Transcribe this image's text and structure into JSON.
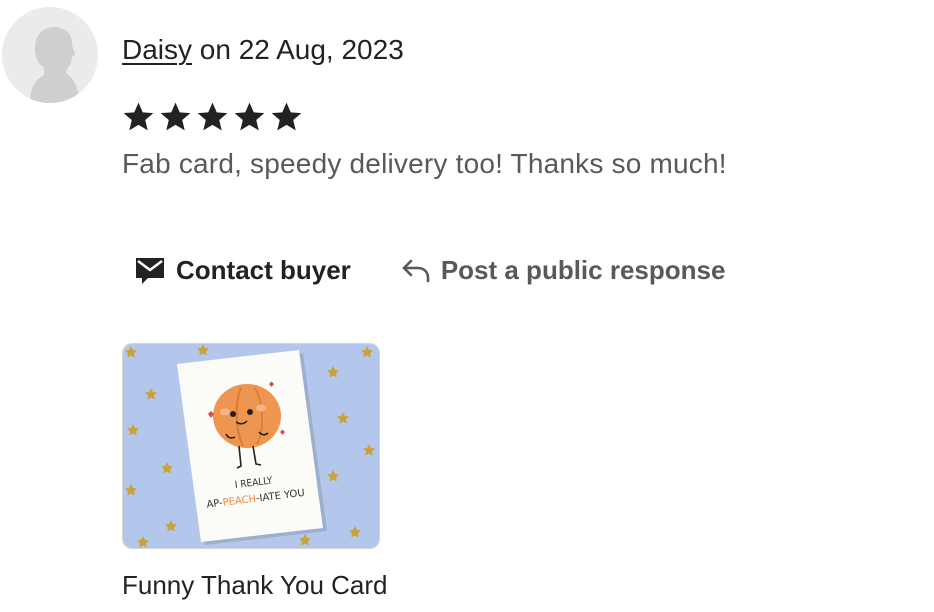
{
  "review": {
    "author": "Daisy",
    "date_text": " on 22 Aug, 2023",
    "rating": 5,
    "max_rating": 5,
    "text": "Fab card, speedy delivery too! Thanks so much!"
  },
  "actions": {
    "contact_label": "Contact buyer",
    "respond_label": "Post a public response"
  },
  "photo": {
    "card_text_line1": "I REALLY",
    "card_text_line2_a": "AP-",
    "card_text_line2_b": "PEACH",
    "card_text_line2_c": "-IATE YOU"
  },
  "listing": {
    "title": "Funny Thank You Card"
  },
  "colors": {
    "star": "#222222",
    "photo_bg": "#b3c7ec",
    "peach": "#ee9550",
    "peach_text": "#ef8a3d"
  }
}
